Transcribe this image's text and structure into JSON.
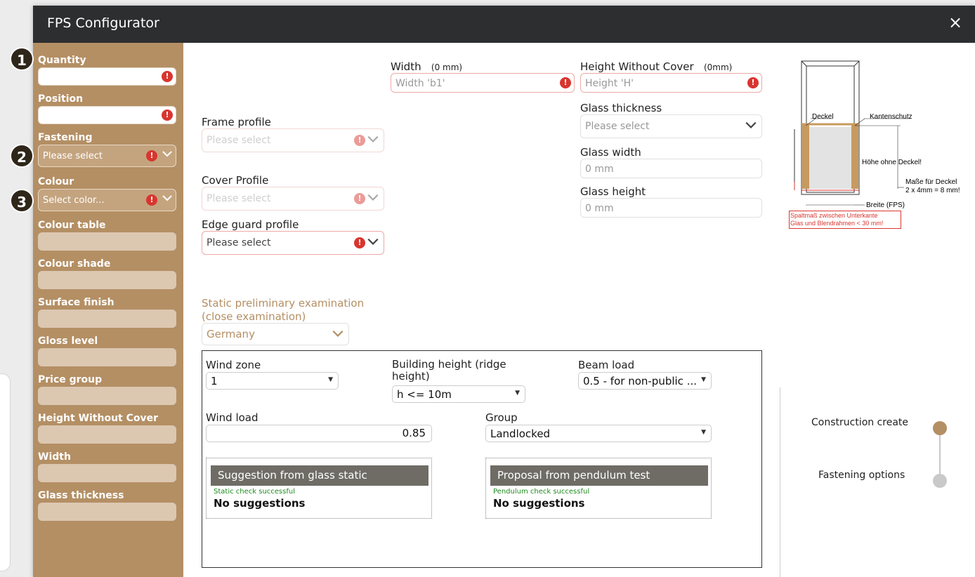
{
  "window": {
    "title": "FPS Configurator",
    "close_icon": "×"
  },
  "badges": [
    "1",
    "2",
    "3"
  ],
  "sidebar": {
    "quantity": "Quantity",
    "position": "Position",
    "fastening": "Fastening",
    "fastening_value": "Please select",
    "colour": "Colour",
    "colour_value": "Select color...",
    "colour_table": "Colour table",
    "colour_shade": "Colour shade",
    "surface_finish": "Surface finish",
    "gloss_level": "Gloss level",
    "price_group": "Price group",
    "height_without_cover": "Height Without Cover",
    "width": "Width",
    "glass_thickness": "Glass thickness"
  },
  "form": {
    "width_label": "Width",
    "width_unit": "(0 mm)",
    "width_placeholder": "Width 'b1'",
    "height_label": "Height Without Cover",
    "height_unit": "(0mm)",
    "height_placeholder": "Height 'H'",
    "frame_profile": "Frame profile",
    "frame_profile_placeholder": "Please select",
    "cover_profile": "Cover Profile",
    "cover_profile_placeholder": "Please select",
    "edge_guard_profile": "Edge guard profile",
    "edge_guard_placeholder": "Please select",
    "glass_thickness": "Glass thickness",
    "glass_thickness_placeholder": "Please select",
    "glass_width": "Glass width",
    "glass_width_value": "0 mm",
    "glass_height": "Glass height",
    "glass_height_value": "0 mm"
  },
  "static": {
    "title": "Static preliminary examination (close examination)",
    "country": "Germany",
    "wind_zone_label": "Wind zone",
    "wind_zone_value": "1",
    "building_height_label": "Building height (ridge height)",
    "building_height_value": "h <= 10m",
    "beam_load_label": "Beam load",
    "beam_load_value": "0.5 - for non-public ...",
    "wind_load_label": "Wind load",
    "wind_load_value": "0.85",
    "group_label": "Group",
    "group_value": "Landlocked",
    "glass_static": {
      "header": "Suggestion from glass static",
      "status": "Static check successful",
      "result": "No suggestions"
    },
    "pendulum": {
      "header": "Proposal from pendulum test",
      "status": "Pendulum check successful",
      "result": "No suggestions"
    }
  },
  "diagram": {
    "deckel": "Deckel",
    "kantenschutz": "Kantenschutz",
    "hoehe": "Höhe ohne Deckel!",
    "masse_1": "Maße für Deckel",
    "masse_2": "2 x 4mm = 8 mm!",
    "breite": "Breite (FPS)",
    "spalt_1": "Spaltmaß zwischen Unterkante",
    "spalt_2": "Glas und Blendrahmen < 30 mm!"
  },
  "steps": [
    {
      "label": "Construction create",
      "color": "#b48f64"
    },
    {
      "label": "Fastening options",
      "color": "#c9c9c9"
    }
  ],
  "colors": {
    "accent": "#b48f64",
    "titlebar": "#2c2e30",
    "error": "#d9352f"
  }
}
